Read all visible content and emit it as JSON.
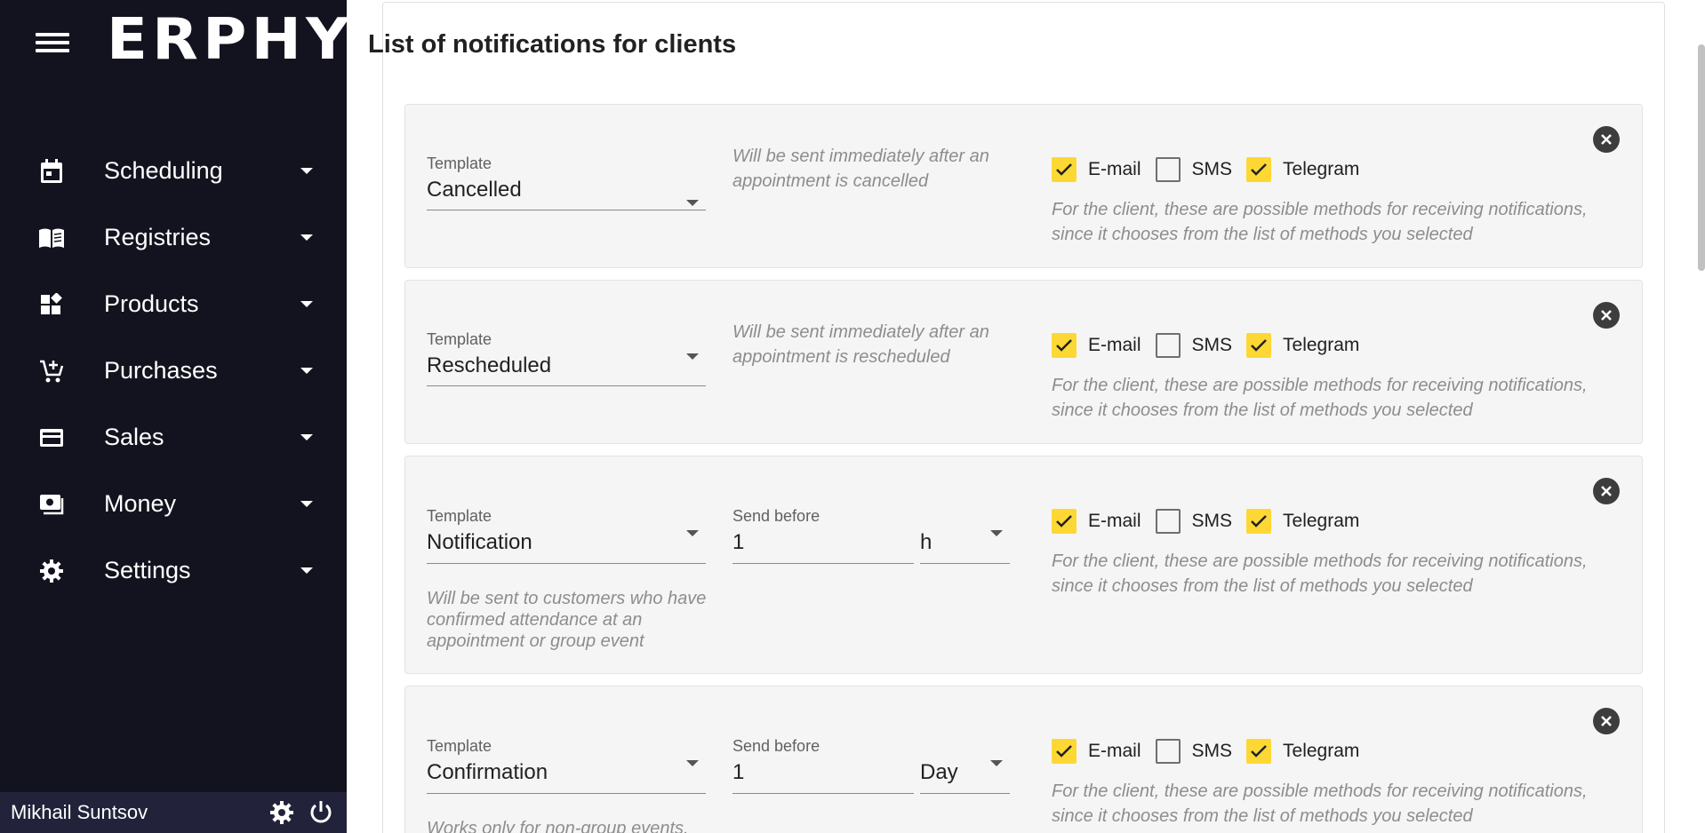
{
  "app": {
    "logo": "ERPHY"
  },
  "sidebar": {
    "items": [
      {
        "label": "Scheduling"
      },
      {
        "label": "Registries"
      },
      {
        "label": "Products"
      },
      {
        "label": "Purchases"
      },
      {
        "label": "Sales"
      },
      {
        "label": "Money"
      },
      {
        "label": "Settings"
      }
    ],
    "user_name": "Mikhail Suntsov"
  },
  "main": {
    "title": "List of notifications for clients",
    "methods_note": "For the client, these are possible methods for receiving notifications, since it chooses from the list of methods you selected",
    "method_labels": {
      "email": "E-mail",
      "sms": "SMS",
      "telegram": "Telegram"
    },
    "rows": [
      {
        "template_label": "Template",
        "template_value": "Cancelled",
        "description": "Will be sent immediately after an appointment is cancelled",
        "email": true,
        "sms": false,
        "telegram": true
      },
      {
        "template_label": "Template",
        "template_value": "Rescheduled",
        "description": "Will be sent immediately after an appointment is rescheduled",
        "email": true,
        "sms": false,
        "telegram": true
      },
      {
        "template_label": "Template",
        "template_value": "Notification",
        "send_before_label": "Send before",
        "send_before_value": "1",
        "unit_value": "h",
        "description": "Will be sent to customers who have confirmed attendance at an appointment or group event",
        "email": true,
        "sms": false,
        "telegram": true
      },
      {
        "template_label": "Template",
        "template_value": "Confirmation",
        "send_before_label": "Send before",
        "send_before_value": "1",
        "unit_value": "Day",
        "description": "Works only for non-group events.",
        "email": true,
        "sms": false,
        "telegram": true
      }
    ]
  },
  "colors": {
    "sidebar_bg": "#131320",
    "footer_bg": "#22233a",
    "checkbox_on": "#fdd835"
  }
}
